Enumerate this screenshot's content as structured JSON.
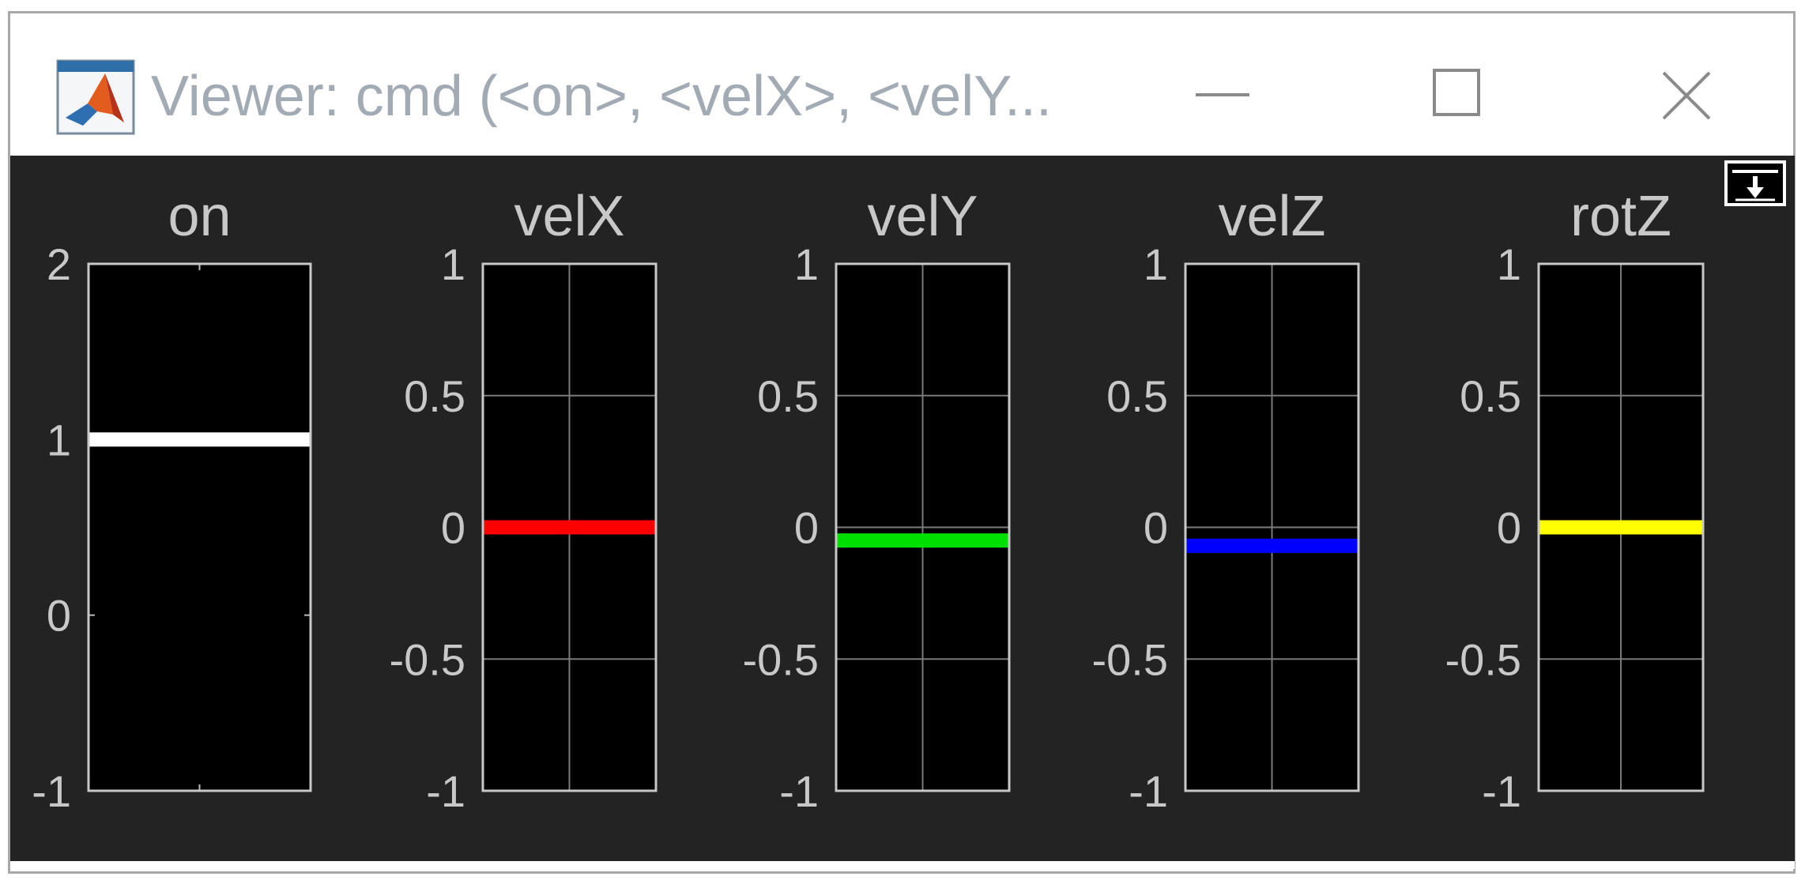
{
  "window": {
    "title": "Viewer: cmd (<on>, <velX>, <velY...",
    "controls": {
      "minimize": "minimize",
      "maximize": "maximize",
      "close": "close"
    },
    "background": "#232323"
  },
  "undock_icon": "undock-arrow-icon",
  "chart_data": [
    {
      "type": "bar-level-indicator",
      "title": "on",
      "ylim": [
        -1,
        2
      ],
      "ytick_labels": [
        "2",
        "1",
        "0",
        "-1"
      ],
      "yticks": [
        2,
        1,
        0,
        -1
      ],
      "grid": false,
      "value": 1.0,
      "color": "#ffffff"
    },
    {
      "type": "bar-level-indicator",
      "title": "velX",
      "ylim": [
        -1,
        1
      ],
      "ytick_labels": [
        "1",
        "0.5",
        "0",
        "-0.5",
        "-1"
      ],
      "yticks": [
        1,
        0.5,
        0,
        -0.5,
        -1
      ],
      "grid": true,
      "value": 0.0,
      "color": "#ff0000"
    },
    {
      "type": "bar-level-indicator",
      "title": "velY",
      "ylim": [
        -1,
        1
      ],
      "ytick_labels": [
        "1",
        "0.5",
        "0",
        "-0.5",
        "-1"
      ],
      "yticks": [
        1,
        0.5,
        0,
        -0.5,
        -1
      ],
      "grid": true,
      "value": -0.05,
      "color": "#00e000"
    },
    {
      "type": "bar-level-indicator",
      "title": "velZ",
      "ylim": [
        -1,
        1
      ],
      "ytick_labels": [
        "1",
        "0.5",
        "0",
        "-0.5",
        "-1"
      ],
      "yticks": [
        1,
        0.5,
        0,
        -0.5,
        -1
      ],
      "grid": true,
      "value": -0.07,
      "color": "#0000ff"
    },
    {
      "type": "bar-level-indicator",
      "title": "rotZ",
      "ylim": [
        -1,
        1
      ],
      "ytick_labels": [
        "1",
        "0.5",
        "0",
        "-0.5",
        "-1"
      ],
      "yticks": [
        1,
        0.5,
        0,
        -0.5,
        -1
      ],
      "grid": true,
      "value": 0.0,
      "color": "#ffff00"
    }
  ]
}
